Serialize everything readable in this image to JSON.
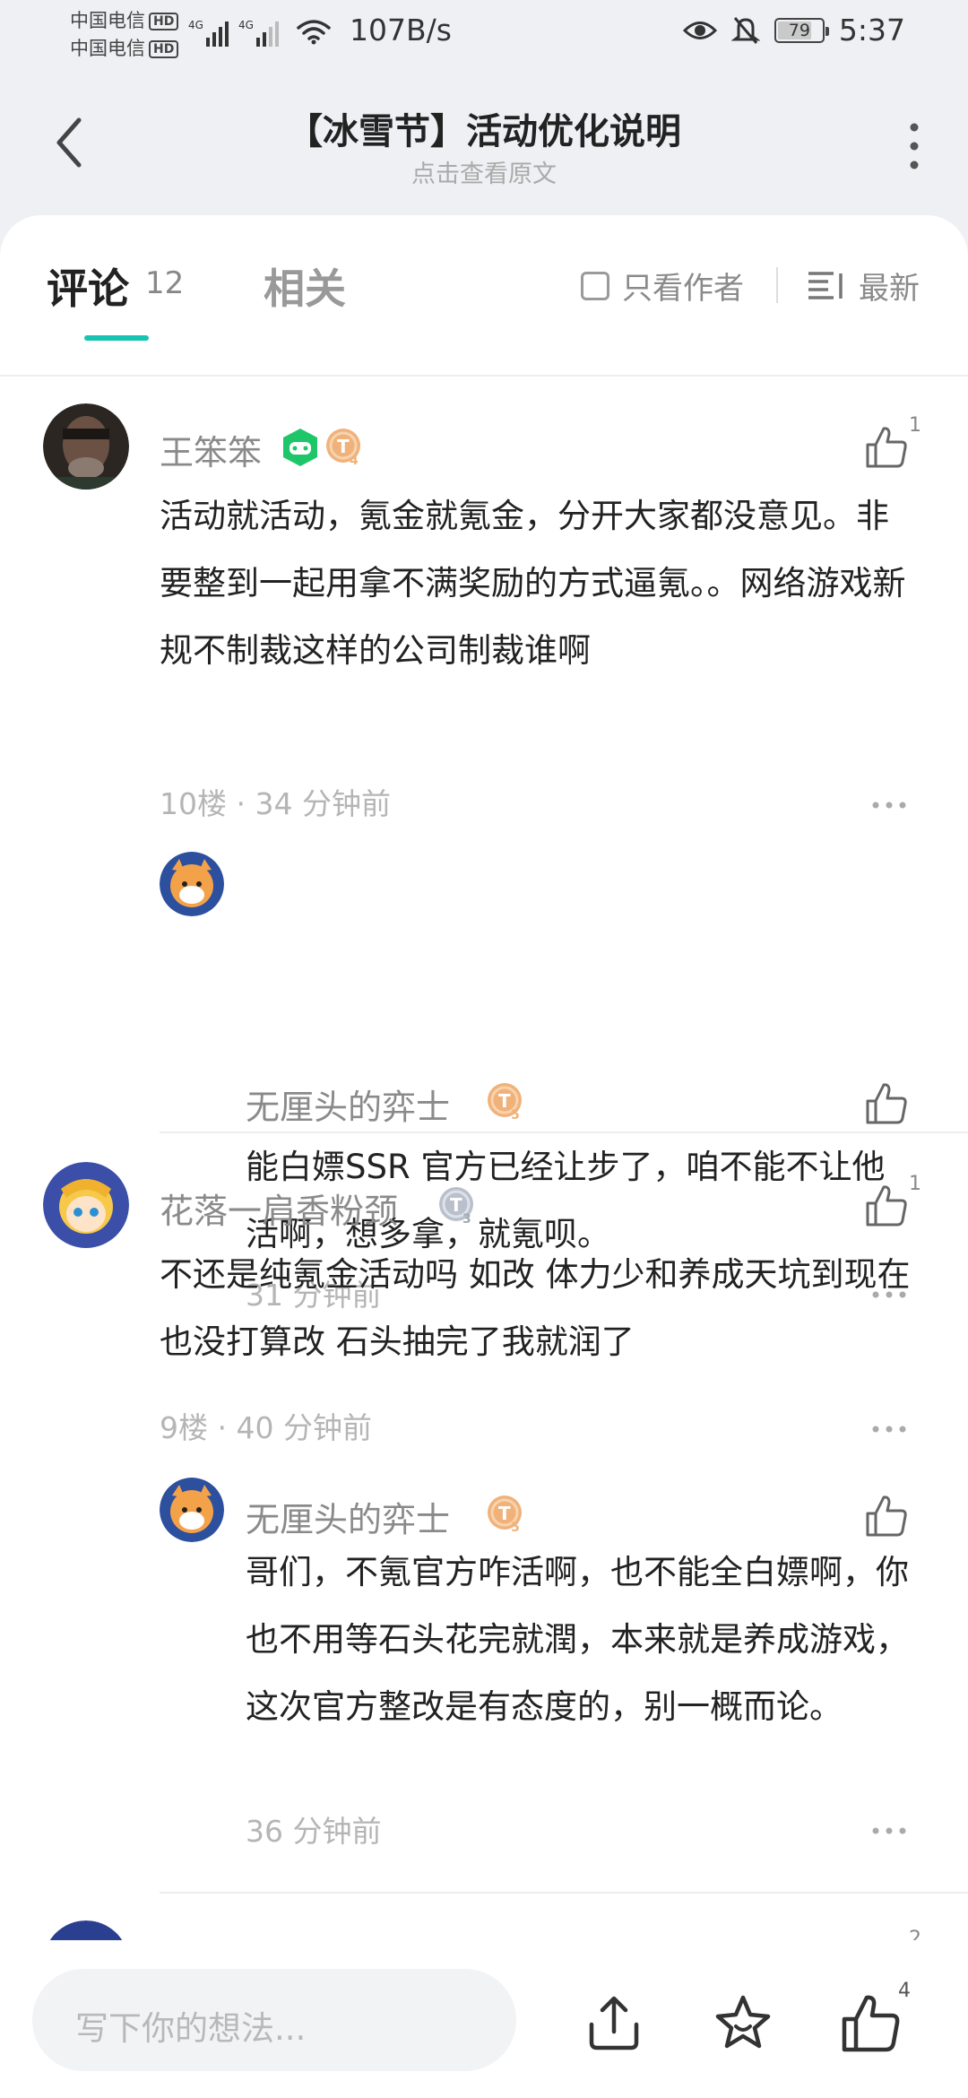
{
  "status_bar": {
    "carrier_1": "中国电信",
    "carrier_2": "中国电信",
    "hd": "HD",
    "network_1": "4G",
    "network_2": "4G",
    "speed": "107B/s",
    "battery": "79",
    "battery_level": 0.79,
    "time": "5:37"
  },
  "header": {
    "title": "【冰雪节】活动优化说明",
    "subtitle": "点击查看原文"
  },
  "tabs": {
    "comments_label": "评论",
    "comments_count": "12",
    "related_label": "相关",
    "author_only_label": "只看作者",
    "sort_label": "最新"
  },
  "comments": [
    {
      "user": "王笨笨",
      "level_badge": "T4",
      "has_game_badge": true,
      "likes": "1",
      "text": "活动就活动，氪金就氪金，分开大家都没意见。非要整到一起用拿不满奖励的方式逼氪。。网络游戏新规不制裁这样的公司制裁谁啊",
      "meta": "10楼 · 34 分钟前",
      "reply": {
        "user": "无厘头的弈士",
        "level_badge": "T5",
        "likes": "",
        "text": "能白嫖SSR 官方已经让步了，咱不能不让他活啊，想多拿，就氪呗。",
        "meta": "31 分钟前"
      }
    },
    {
      "user": "花落一肩香粉颈",
      "level_badge": "T3",
      "has_game_badge": false,
      "likes": "1",
      "text": "不还是纯氪金活动吗 如改 体力少和养成天坑到现在也没打算改 石头抽完了我就润了",
      "meta": "9楼 · 40 分钟前",
      "reply": {
        "user": "无厘头的弈士",
        "level_badge": "T5",
        "likes": "",
        "text": "哥们，不氪官方咋活啊，也不能全白嫖啊，你也不用等石头花完就潤，本来就是养成游戏，这次官方整改是有态度的，别一概而论。",
        "meta": "36 分钟前"
      }
    },
    {
      "likes": "2"
    }
  ],
  "bottom_bar": {
    "compose_placeholder": "写下你的想法...",
    "like_count": "4"
  },
  "colors": {
    "accent": "#19c3b3",
    "badge_gold": "#f0b27a",
    "badge_silver": "#b9c0cc",
    "game_badge": "#1ec66a"
  }
}
